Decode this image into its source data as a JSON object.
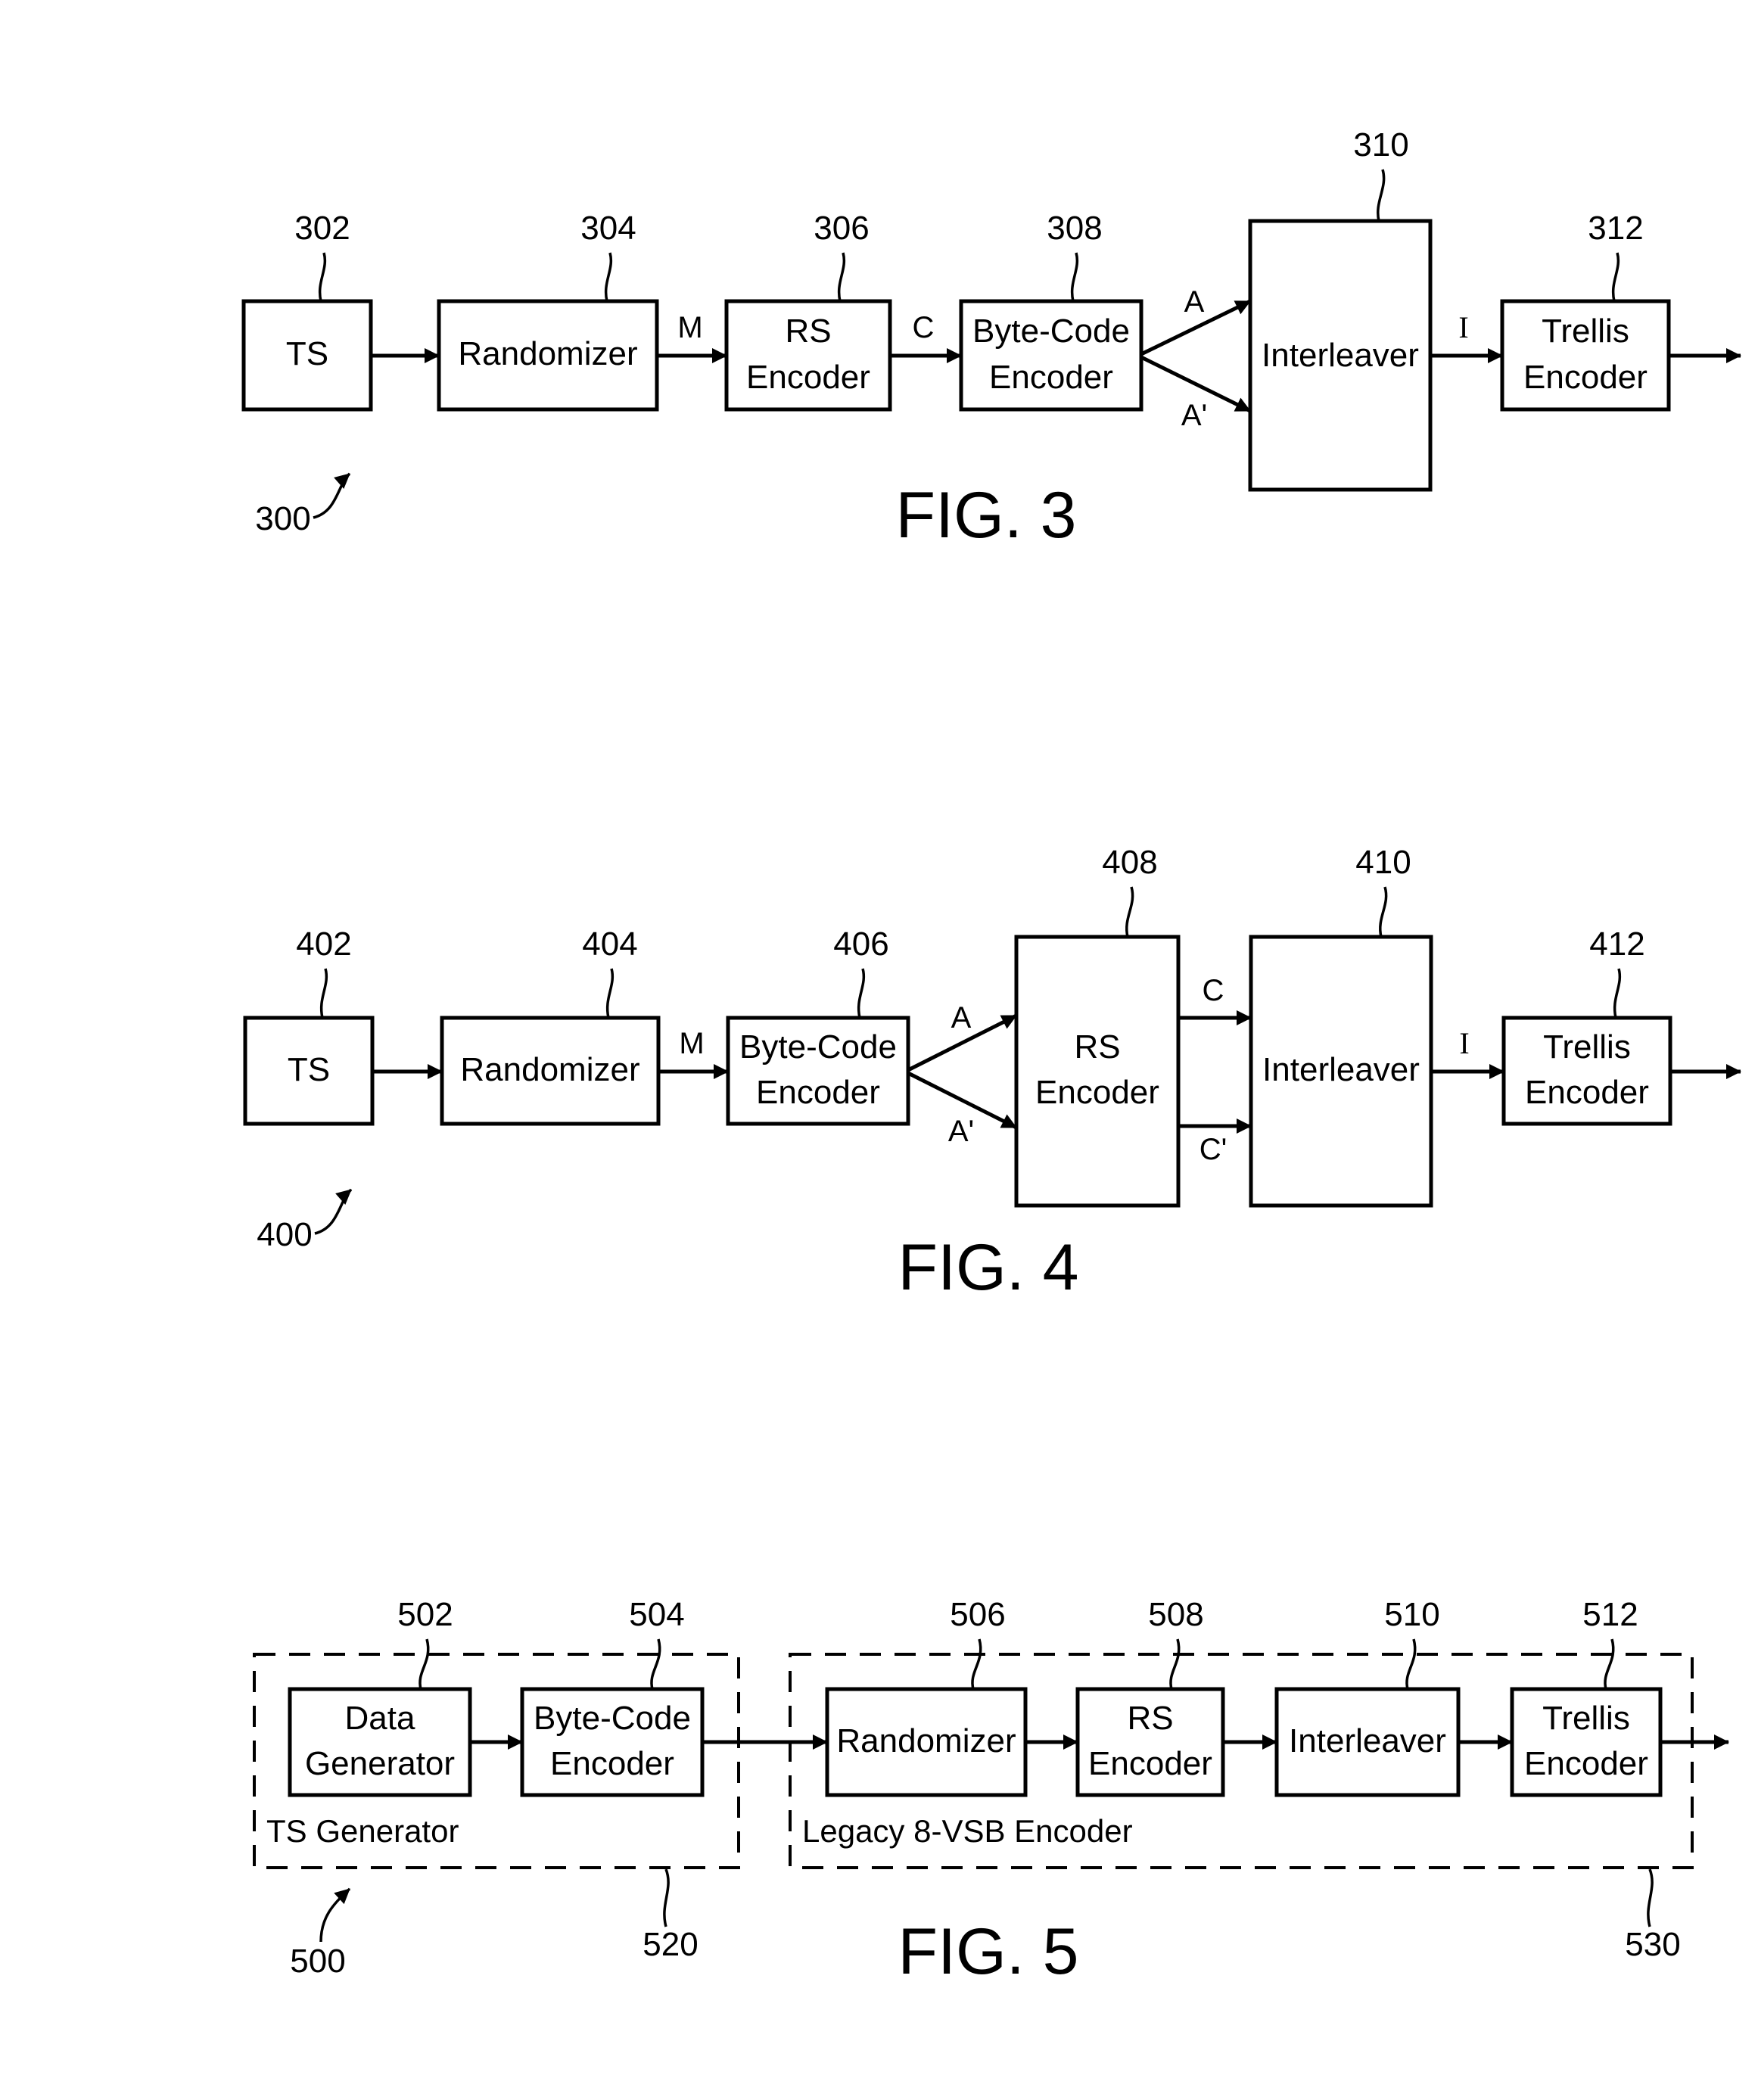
{
  "colors": {
    "ink": "#000000",
    "paper": "#ffffff"
  },
  "fig3": {
    "caption": "FIG. 3",
    "system_ref": "300",
    "blocks": [
      {
        "id": "ts",
        "ref": "302",
        "lines": [
          "TS"
        ]
      },
      {
        "id": "randomizer",
        "ref": "304",
        "lines": [
          "Randomizer"
        ]
      },
      {
        "id": "rs-encoder",
        "ref": "306",
        "lines": [
          "RS",
          "Encoder"
        ]
      },
      {
        "id": "byte-code-encoder",
        "ref": "308",
        "lines": [
          "Byte-Code",
          "Encoder"
        ]
      },
      {
        "id": "interleaver",
        "ref": "310",
        "lines": [
          "Interleaver"
        ]
      },
      {
        "id": "trellis-encoder",
        "ref": "312",
        "lines": [
          "Trellis",
          "Encoder"
        ]
      }
    ],
    "signals": {
      "m": "M",
      "c": "C",
      "a": "A",
      "a_prime": "A'",
      "i": "I"
    }
  },
  "fig4": {
    "caption": "FIG. 4",
    "system_ref": "400",
    "blocks": [
      {
        "id": "ts",
        "ref": "402",
        "lines": [
          "TS"
        ]
      },
      {
        "id": "randomizer",
        "ref": "404",
        "lines": [
          "Randomizer"
        ]
      },
      {
        "id": "byte-code-encoder",
        "ref": "406",
        "lines": [
          "Byte-Code",
          "Encoder"
        ]
      },
      {
        "id": "rs-encoder",
        "ref": "408",
        "lines": [
          "RS",
          "Encoder"
        ]
      },
      {
        "id": "interleaver",
        "ref": "410",
        "lines": [
          "Interleaver"
        ]
      },
      {
        "id": "trellis-encoder",
        "ref": "412",
        "lines": [
          "Trellis",
          "Encoder"
        ]
      }
    ],
    "signals": {
      "m": "M",
      "a": "A",
      "a_prime": "A'",
      "c": "C",
      "c_prime": "C'",
      "i": "I"
    }
  },
  "fig5": {
    "caption": "FIG. 5",
    "system_ref": "500",
    "groups": [
      {
        "id": "ts-generator",
        "ref": "520",
        "label": "TS Generator"
      },
      {
        "id": "legacy-encoder",
        "ref": "530",
        "label": "Legacy 8-VSB Encoder"
      }
    ],
    "blocks": [
      {
        "id": "data-generator",
        "ref": "502",
        "lines": [
          "Data",
          "Generator"
        ]
      },
      {
        "id": "byte-code-encoder",
        "ref": "504",
        "lines": [
          "Byte-Code",
          "Encoder"
        ]
      },
      {
        "id": "randomizer",
        "ref": "506",
        "lines": [
          "Randomizer"
        ]
      },
      {
        "id": "rs-encoder",
        "ref": "508",
        "lines": [
          "RS",
          "Encoder"
        ]
      },
      {
        "id": "interleaver",
        "ref": "510",
        "lines": [
          "Interleaver"
        ]
      },
      {
        "id": "trellis-encoder",
        "ref": "512",
        "lines": [
          "Trellis",
          "Encoder"
        ]
      }
    ]
  }
}
